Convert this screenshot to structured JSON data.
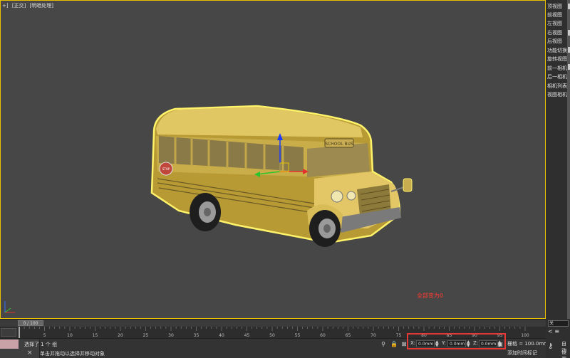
{
  "viewport": {
    "labels": [
      "+]",
      "[正交]",
      "[明暗处理]"
    ],
    "annotation": "全部变为0"
  },
  "view_menu": {
    "items": [
      "顶视图",
      "前视图",
      "左视图",
      "右视图",
      "后视图",
      "功能切换",
      "旋转视图",
      "前一相机",
      "后一相机",
      "相机列表",
      "视图相机"
    ]
  },
  "timeline": {
    "frame_display": "0 / 100",
    "ticks": [
      "0",
      "5",
      "10",
      "15",
      "20",
      "25",
      "30",
      "35",
      "40",
      "45",
      "50",
      "55",
      "60",
      "65",
      "70",
      "75",
      "80",
      "85",
      "90",
      "95",
      "100"
    ],
    "current_frame": 0
  },
  "status": {
    "selection": "选择了 1 个 组",
    "prompt": "单击并拖动以选择并移动对象",
    "close_glyph": "×",
    "x_label": "X:",
    "x_value": "0.0mm",
    "y_label": "Y:",
    "y_value": "0.0mm",
    "z_label": "Z:",
    "z_value": "0.0mm",
    "grid": "栅格 = 100.0mm",
    "add_time_tag": "添加时间标记"
  },
  "right_bottom": {
    "field_text": "关",
    "arrows": "< ≡",
    "auto": "自动",
    "set": "设置"
  },
  "bus": {
    "sign_text": "SCHOOL BUS",
    "stop_text": "STOP"
  },
  "colors": {
    "viewport_border": "#e8c200",
    "annotation": "#ff3b2f",
    "highlight_box": "#e53935",
    "bus_body": "#d9c060",
    "selection_outline": "#fff36a"
  }
}
